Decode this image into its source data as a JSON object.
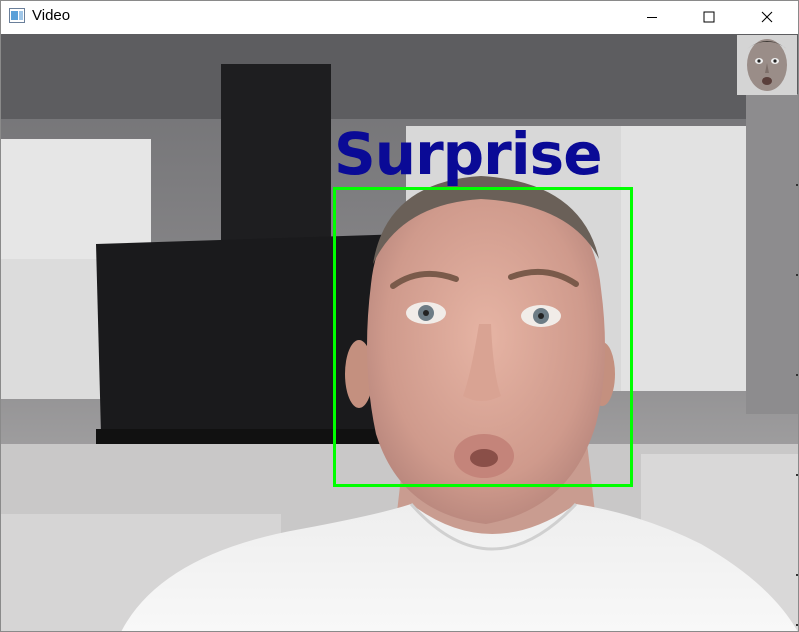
{
  "window": {
    "title": "Video",
    "controls": [
      "minimize-icon",
      "maximize-icon",
      "close-icon"
    ]
  },
  "overlay": {
    "emotion_label": "Surprise",
    "label_color": "#0a0a96",
    "box_color": "#00ff00"
  },
  "colors": {
    "titlebar": "#ffffff",
    "frame_border": "#8a8a8a"
  }
}
